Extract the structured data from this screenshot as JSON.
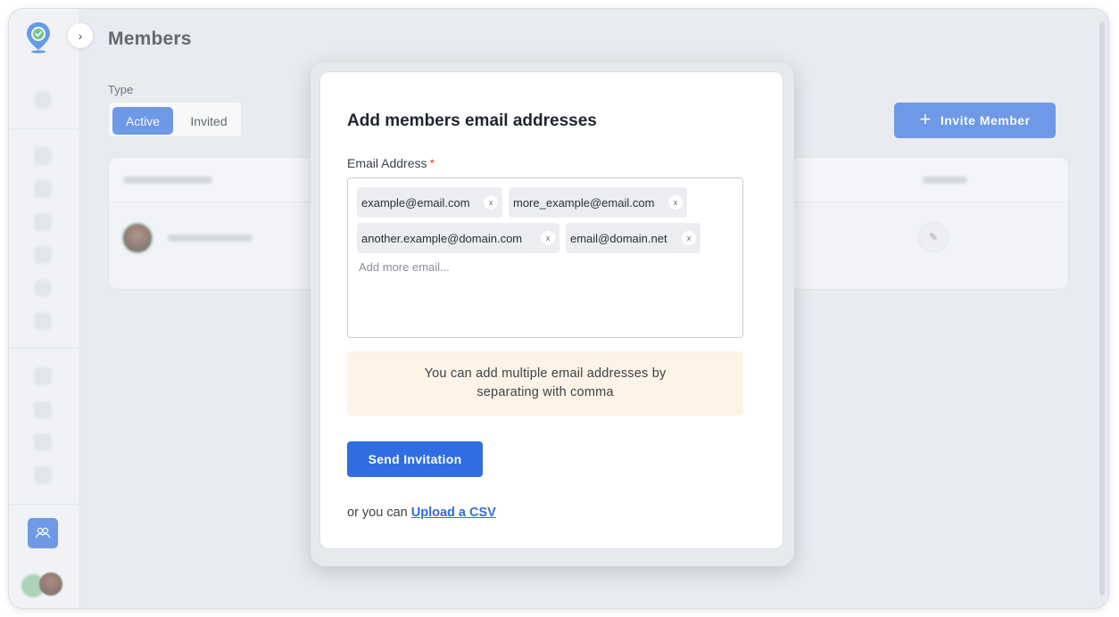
{
  "page": {
    "title": "Members"
  },
  "sidebar": {
    "active_item_icon": "members-icon",
    "colors": {
      "active": "#2f6de1"
    }
  },
  "filters": {
    "type_label": "Type",
    "segments": [
      {
        "label": "Active",
        "selected": true
      },
      {
        "label": "Invited",
        "selected": false
      }
    ]
  },
  "toolbar": {
    "invite_label": "Invite Member"
  },
  "modal": {
    "title": "Add members email addresses",
    "field_label": "Email Address",
    "required_mark": "*",
    "emails": [
      "example@email.com",
      "more_example@email.com",
      "another.example@domain.com",
      "email@domain.net"
    ],
    "chip_remove": "x",
    "placeholder": "Add more email...",
    "hint": "You can add multiple email addresses by separating with comma",
    "send_label": "Send Invitation",
    "csv_prefix": "or you can",
    "csv_link": "Upload a CSV"
  },
  "colors": {
    "primary": "#2f6de1",
    "hint_bg": "#fdf3e6",
    "required": "#e0443c"
  }
}
